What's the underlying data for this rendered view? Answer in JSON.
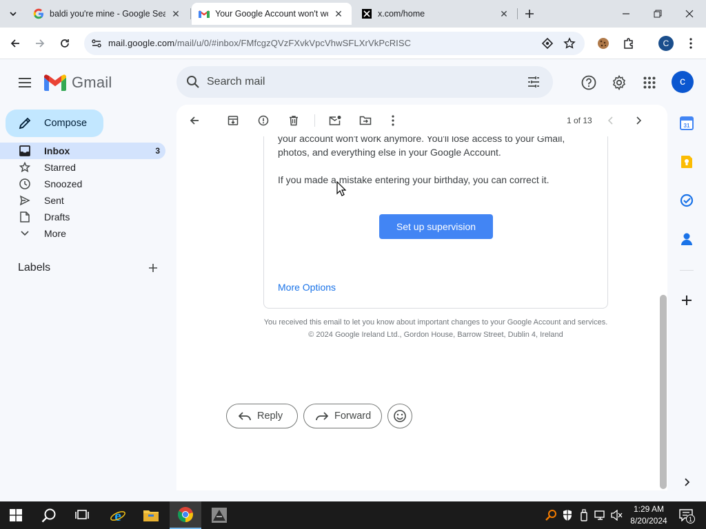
{
  "browser": {
    "tabs": [
      {
        "title": "baldi you're mine - Google Sea",
        "favicon": "google-g-icon",
        "active": false
      },
      {
        "title": "Your Google Account won't wo",
        "favicon": "gmail-icon",
        "active": true
      },
      {
        "title": "x.com/home",
        "favicon": "x-icon",
        "active": false
      }
    ],
    "url_host": "mail.google.com",
    "url_path": "/mail/u/0/#inbox/FMfcgzQVzFXvkVpcVhwSFLXrVkPcRISC",
    "profile_initial": "C"
  },
  "gmail": {
    "wordmark": "Gmail",
    "search_placeholder": "Search mail",
    "avatar_initial": "c",
    "compose_label": "Compose",
    "nav": [
      {
        "label": "Inbox",
        "count": "3",
        "icon": "inbox-icon",
        "active": true
      },
      {
        "label": "Starred",
        "count": "",
        "icon": "star-icon",
        "active": false
      },
      {
        "label": "Snoozed",
        "count": "",
        "icon": "clock-icon",
        "active": false
      },
      {
        "label": "Sent",
        "count": "",
        "icon": "send-icon",
        "active": false
      },
      {
        "label": "Drafts",
        "count": "",
        "icon": "draft-icon",
        "active": false
      },
      {
        "label": "More",
        "count": "",
        "icon": "chevron-down-icon",
        "active": false
      }
    ],
    "labels_title": "Labels",
    "pager": "1 of 13"
  },
  "email": {
    "para1_line1": "your account won't work anymore. You'll lose access to your Gmail,",
    "para1_line2": "photos, and everything else in your Google Account.",
    "para2": "If you made a mistake entering your birthday, you can correct it.",
    "cta_label": "Set up supervision",
    "more_options": "More Options",
    "footer1": "You received this email to let you know about important changes to your Google Account and services.",
    "footer2": "© 2024 Google Ireland Ltd., Gordon House, Barrow Street, Dublin 4, Ireland",
    "reply_label": "Reply",
    "forward_label": "Forward"
  },
  "taskbar": {
    "time": "1:29 AM",
    "date": "8/20/2024",
    "notification_count": "1"
  },
  "colors": {
    "accent_blue": "#4285f4",
    "link_blue": "#1a73e8",
    "compose_bg": "#c2e7ff",
    "inbox_active_bg": "#d3e3fd"
  }
}
